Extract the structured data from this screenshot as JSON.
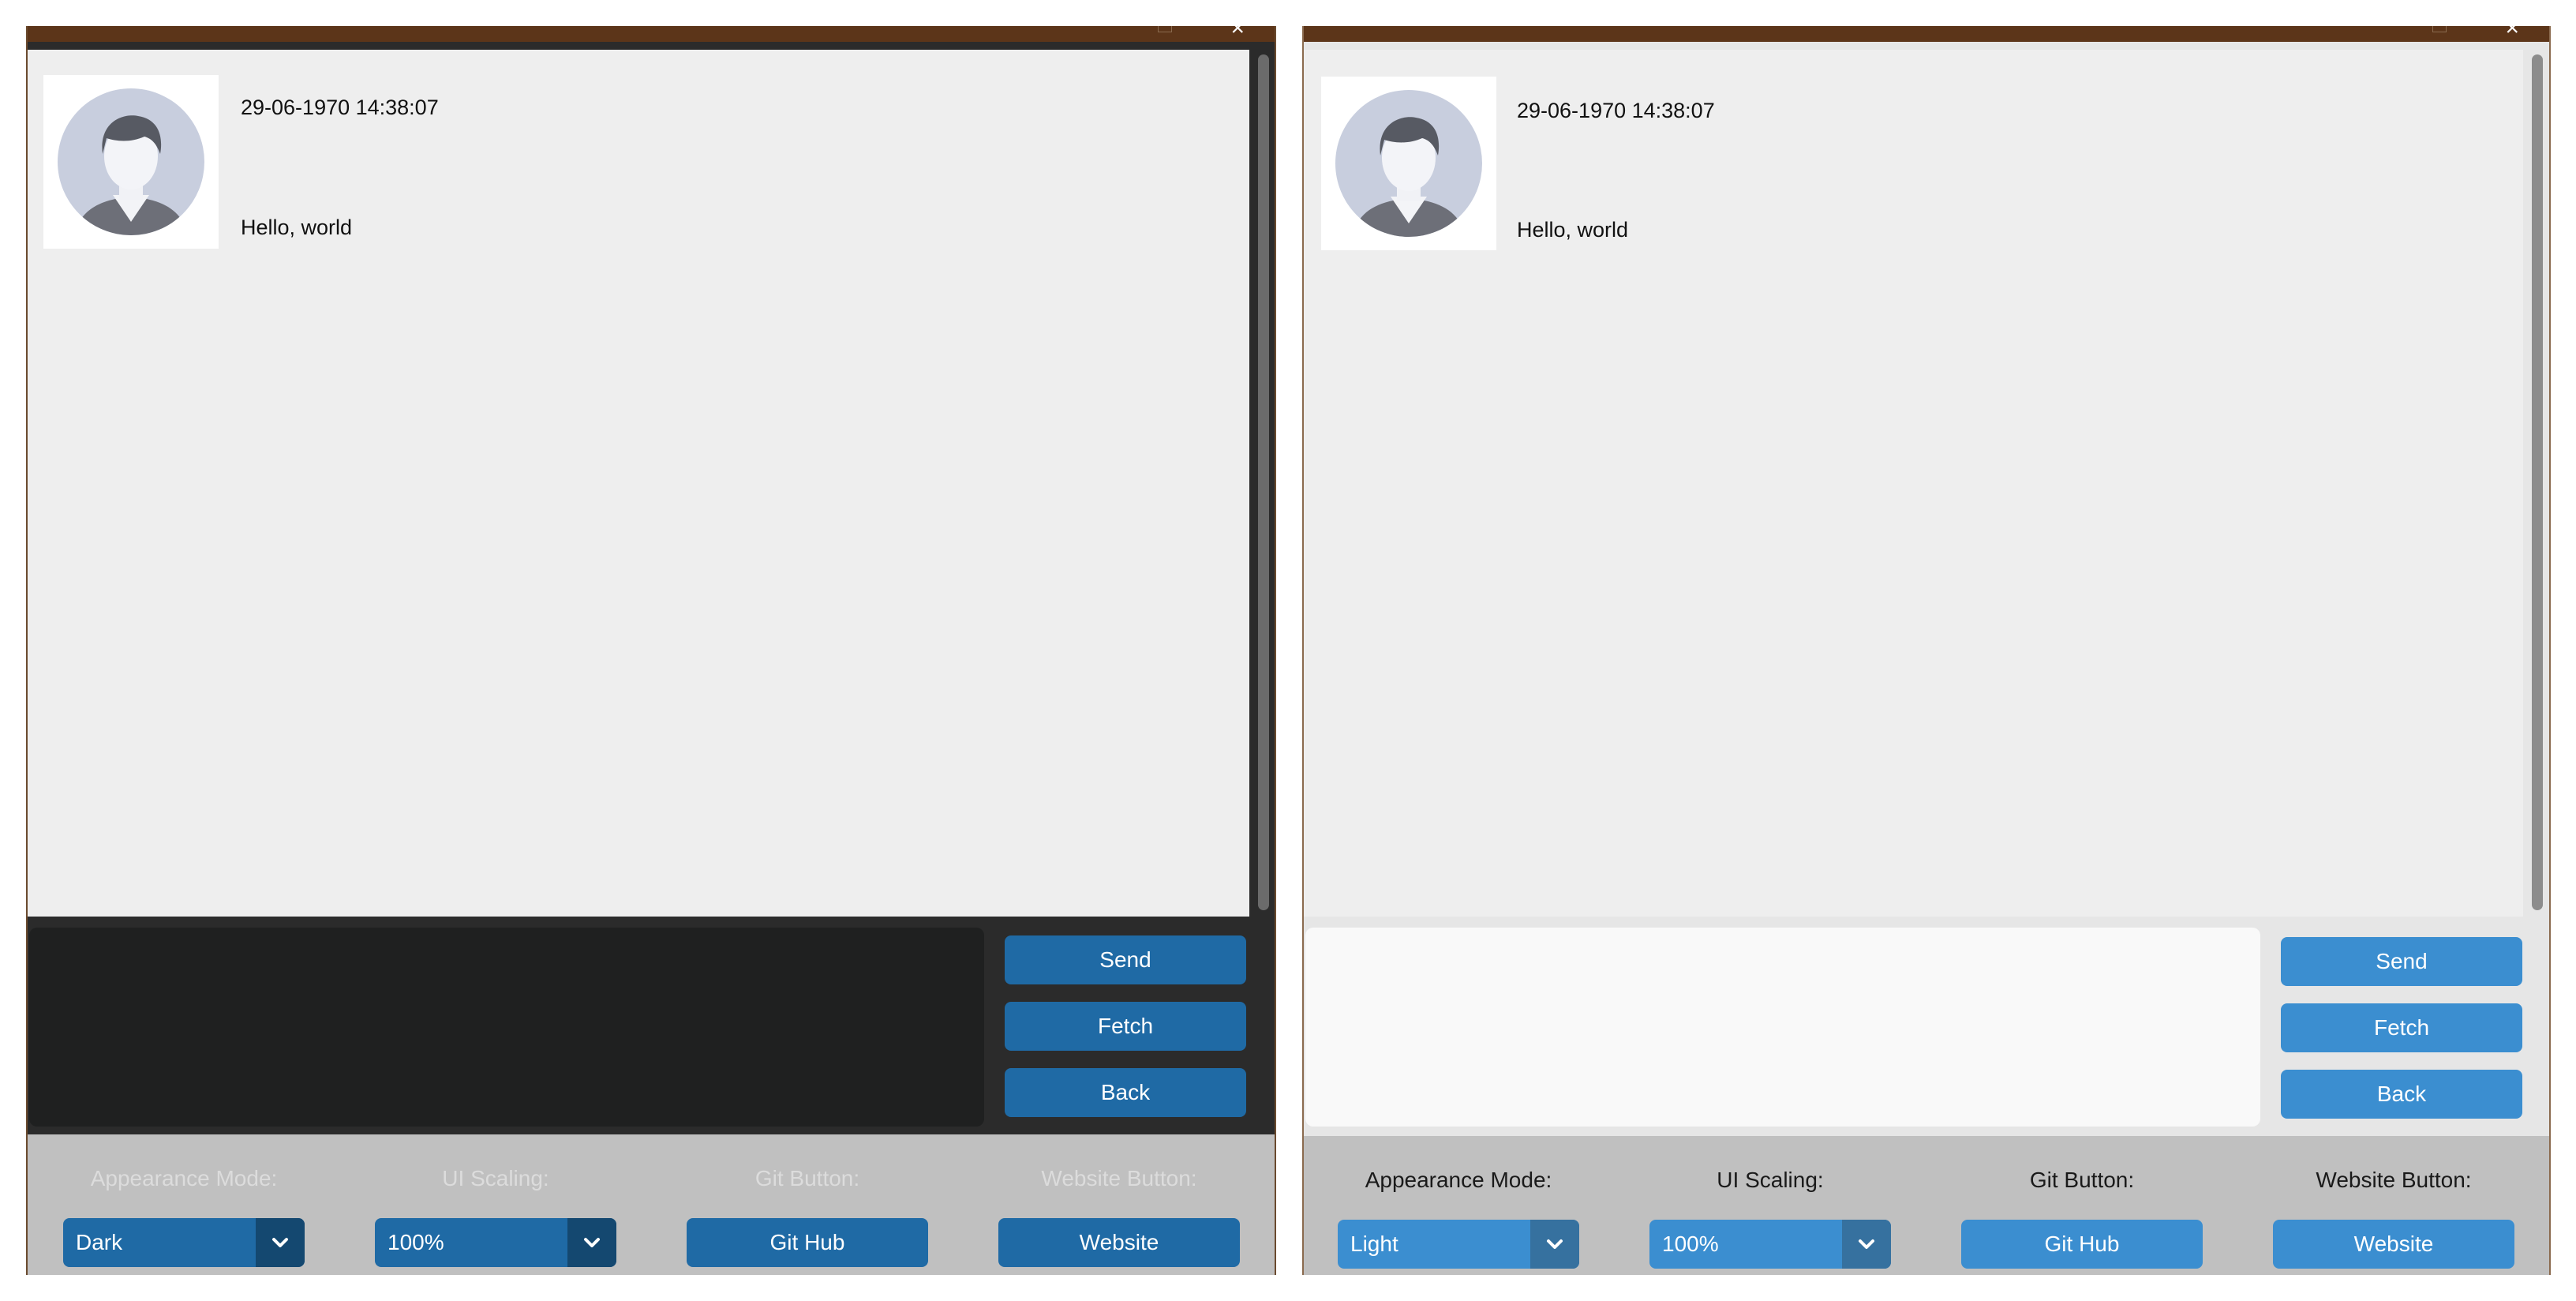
{
  "windows": [
    {
      "theme": "dark",
      "message": {
        "timestamp": "29-06-1970 14:38:07",
        "text": "Hello, world"
      },
      "buttons": {
        "send": "Send",
        "fetch": "Fetch",
        "back": "Back"
      },
      "settings": {
        "appearance_label": "Appearance Mode:",
        "appearance_value": "Dark",
        "scaling_label": "UI Scaling:",
        "scaling_value": "100%",
        "git_label": "Git Button:",
        "git_button": "Git Hub",
        "website_label": "Website Button:",
        "website_button": "Website"
      }
    },
    {
      "theme": "light",
      "message": {
        "timestamp": "29-06-1970 14:38:07",
        "text": "Hello, world"
      },
      "buttons": {
        "send": "Send",
        "fetch": "Fetch",
        "back": "Back"
      },
      "settings": {
        "appearance_label": "Appearance Mode:",
        "appearance_value": "Light",
        "scaling_label": "UI Scaling:",
        "scaling_value": "100%",
        "git_label": "Git Button:",
        "git_button": "Git Hub",
        "website_label": "Website Button:",
        "website_button": "Website"
      }
    }
  ],
  "icons": {
    "avatar": "default-user-avatar-icon",
    "dropdown": "chevron-down-icon",
    "close": "close-icon",
    "maximize": "maximize-icon"
  },
  "colors": {
    "titlebar": "#5c3519",
    "chat_background": "#eeeeee",
    "dark_button": "#1f6aa5",
    "dark_dropdown_arrow": "#144870",
    "light_button": "#3b8ed0",
    "light_dropdown_arrow": "#36719f",
    "dark_input": "#1f2020",
    "light_input": "#f9f9f9",
    "settings_bar": "#c0c0c0"
  }
}
